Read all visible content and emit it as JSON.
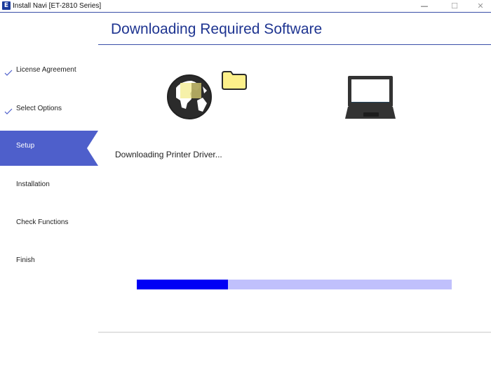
{
  "window": {
    "title": "Install Navi [ET-2810 Series]",
    "app_icon": "E",
    "controls": {
      "minimize": "—",
      "maximize": "☐",
      "close": "✕"
    }
  },
  "header": {
    "title": "Downloading Required Software"
  },
  "sidebar": {
    "steps": [
      {
        "label": "License Agreement",
        "state": "done"
      },
      {
        "label": "Select Options",
        "state": "done"
      },
      {
        "label": "Setup",
        "state": "active"
      },
      {
        "label": "Installation",
        "state": "pending"
      },
      {
        "label": "Check Functions",
        "state": "pending"
      },
      {
        "label": "Finish",
        "state": "pending"
      }
    ]
  },
  "main": {
    "status_text": "Downloading Printer Driver...",
    "icons": {
      "source": "globe-icon",
      "transfer": "folder-icon",
      "destination": "laptop-icon"
    },
    "progress": {
      "percent": 29
    }
  },
  "colors": {
    "accent": "#4e5fcb",
    "title_blue": "#1f3591",
    "progress_fill": "#0000f5",
    "progress_track": "#c0c0fc",
    "folder": "#fdf08a"
  }
}
